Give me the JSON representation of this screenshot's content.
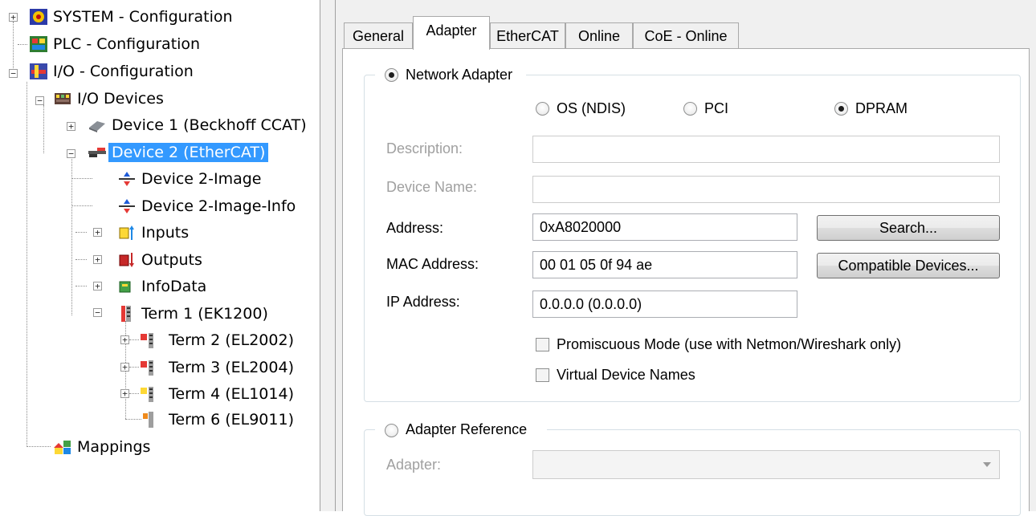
{
  "tree": {
    "system": "SYSTEM - Configuration",
    "plc": "PLC - Configuration",
    "io": "I/O - Configuration",
    "io_devices": "I/O Devices",
    "device1": "Device 1 (Beckhoff CCAT)",
    "device2": "Device 2 (EtherCAT)",
    "image": "Device 2-Image",
    "image_info": "Device 2-Image-Info",
    "inputs": "Inputs",
    "outputs": "Outputs",
    "infodata": "InfoData",
    "term1": "Term 1 (EK1200)",
    "term2": "Term 2 (EL2002)",
    "term3": "Term 3 (EL2004)",
    "term4": "Term 4 (EL1014)",
    "term6": "Term 6 (EL9011)",
    "mappings": "Mappings"
  },
  "tabs": [
    "General",
    "Adapter",
    "EtherCAT",
    "Online",
    "CoE - Online"
  ],
  "active_tab": "Adapter",
  "adapter": {
    "network_adapter": "Network Adapter",
    "os_ndis": "OS (NDIS)",
    "pci": "PCI",
    "dpram": "DPRAM",
    "selected_type": "DPRAM",
    "description_label": "Description:",
    "description_value": "",
    "device_name_label": "Device Name:",
    "device_name_value": "",
    "address_label": "Address:",
    "address_value": "0xA8020000",
    "search_button": "Search...",
    "mac_label": "MAC Address:",
    "mac_value": "00 01 05 0f 94 ae",
    "compatible_button": "Compatible Devices...",
    "ip_label": "IP Address:",
    "ip_value": "0.0.0.0 (0.0.0.0)",
    "promiscuous": "Promiscuous Mode (use with Netmon/Wireshark only)",
    "promiscuous_checked": false,
    "virtual_names": "Virtual Device Names",
    "virtual_names_checked": false,
    "adapter_reference": "Adapter Reference",
    "adapter_label": "Adapter:",
    "adapter_value": ""
  },
  "colors": {
    "selection": "#3399ff",
    "panel_bg": "#f0f0f0",
    "disabled_text": "#a0a0a0"
  }
}
